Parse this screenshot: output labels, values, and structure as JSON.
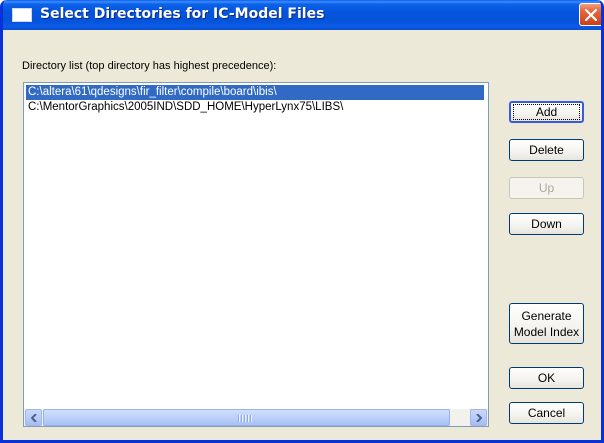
{
  "window": {
    "title": "Select Directories for IC-Model Files"
  },
  "list": {
    "label": "Directory list (top directory has highest precedence):",
    "items": [
      {
        "text": "C:\\altera\\61\\qdesigns\\fir_filter\\compile\\board\\ibis\\",
        "selected": true
      },
      {
        "text": "C:\\MentorGraphics\\2005IND\\SDD_HOME\\HyperLynx75\\LIBS\\",
        "selected": false
      }
    ]
  },
  "buttons": {
    "add": "Add",
    "delete": "Delete",
    "up": "Up",
    "down": "Down",
    "generate": "Generate\nModel Index",
    "ok": "OK",
    "cancel": "Cancel"
  },
  "icons": {
    "close": "close-x-icon",
    "app": "window-icon",
    "scroll_left": "arrow-left-icon",
    "scroll_right": "arrow-right-icon"
  },
  "colors": {
    "selection": "#316ac5",
    "titlebar": "#0553d8",
    "dialog_bg": "#ece9d8"
  }
}
